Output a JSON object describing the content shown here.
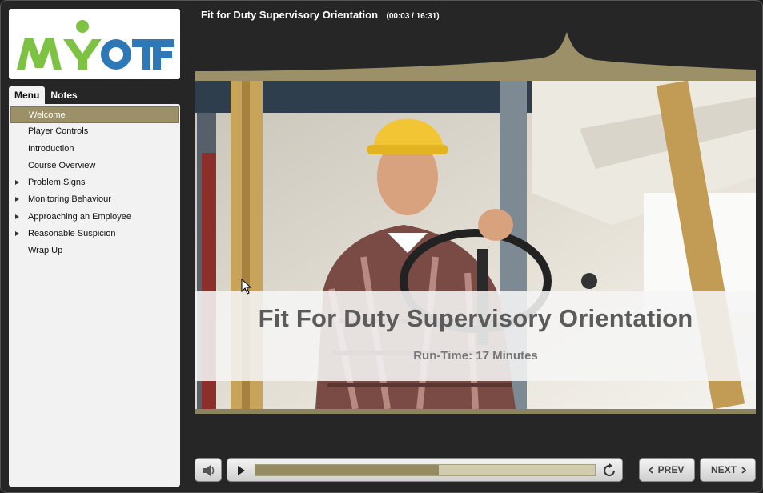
{
  "logo": {
    "text": "MYOTF"
  },
  "tabs": [
    {
      "label": "Menu",
      "active": true
    },
    {
      "label": "Notes",
      "active": false
    }
  ],
  "menu": {
    "items": [
      {
        "label": "Welcome",
        "selected": true,
        "expandable": false
      },
      {
        "label": "Player Controls",
        "selected": false,
        "expandable": false
      },
      {
        "label": "Introduction",
        "selected": false,
        "expandable": false
      },
      {
        "label": "Course Overview",
        "selected": false,
        "expandable": false
      },
      {
        "label": "Problem Signs",
        "selected": false,
        "expandable": true
      },
      {
        "label": "Monitoring Behaviour",
        "selected": false,
        "expandable": true
      },
      {
        "label": "Approaching an Employee",
        "selected": false,
        "expandable": true
      },
      {
        "label": "Reasonable Suspicion",
        "selected": false,
        "expandable": true
      },
      {
        "label": "Wrap Up",
        "selected": false,
        "expandable": false
      }
    ]
  },
  "header": {
    "title": "Fit for Duty Supervisory Orientation",
    "time": "(00:03 / 16:31)"
  },
  "slide": {
    "heading": "Fit For Duty Supervisory Orientation",
    "subheading": "Run-Time: 17 Minutes"
  },
  "controls": {
    "prev_label": "PREV",
    "next_label": "NEXT",
    "progress_fraction": 0.54
  },
  "colors": {
    "accent": "#9b9067",
    "logo_green": "#7dc243",
    "logo_blue": "#2f78b7"
  },
  "icons": {
    "mute": "speaker-icon",
    "play": "play-icon",
    "replay": "replay-icon",
    "prev": "chevron-left-icon",
    "next": "chevron-right-icon"
  }
}
